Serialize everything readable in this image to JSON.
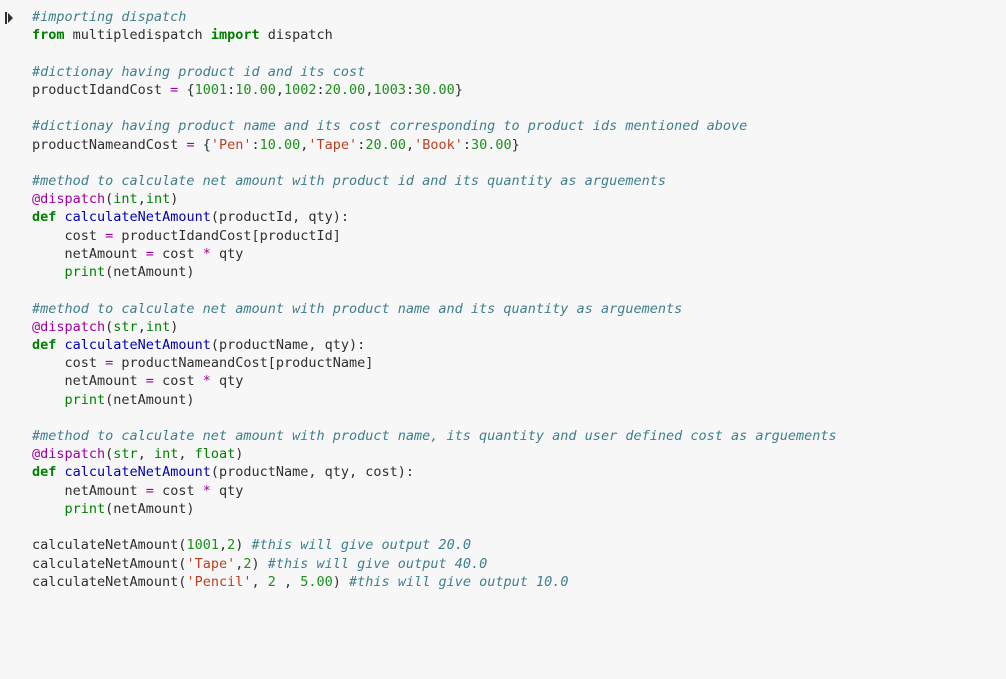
{
  "code": {
    "l1": "#importing dispatch",
    "l2a": "from",
    "l2b": " multipledispatch ",
    "l2c": "import",
    "l2d": " dispatch",
    "l4": "#dictionay having product id and its cost",
    "l5a": "productIdandCost ",
    "l5eq": "=",
    "l5b": " {",
    "l5n1": "1001",
    "l5c": ":",
    "l5n2": "10.00",
    "l5cm": ",",
    "l5n3": "1002",
    "l5c2": ":",
    "l5n4": "20.00",
    "l5cm2": ",",
    "l5n5": "1003",
    "l5c3": ":",
    "l5n6": "30.00",
    "l5e": "}",
    "l7": "#dictionay having product name and its cost corresponding to product ids mentioned above",
    "l8a": "productNameandCost ",
    "l8eq": "=",
    "l8b": " {",
    "l8s1": "'Pen'",
    "l8c": ":",
    "l8n1": "10.00",
    "l8cm": ",",
    "l8s2": "'Tape'",
    "l8c2": ":",
    "l8n2": "20.00",
    "l8cm2": ",",
    "l8s3": "'Book'",
    "l8c3": ":",
    "l8n3": "30.00",
    "l8e": "}",
    "l10": "#method to calculate net amount with product id and its quantity as arguements",
    "l11a": "@dispatch",
    "l11b": "(",
    "l11c": "int",
    "l11d": ",",
    "l11e": "int",
    "l11f": ")",
    "l12a": "def",
    "l12b": " ",
    "l12c": "calculateNetAmount",
    "l12d": "(productId, qty):",
    "l13a": "    cost ",
    "l13eq": "=",
    "l13b": " productIdandCost[productId]",
    "l14a": "    netAmount ",
    "l14eq": "=",
    "l14b": " cost ",
    "l14op": "*",
    "l14c": " qty",
    "l15a": "    ",
    "l15p": "print",
    "l15b": "(netAmount)",
    "l17": "#method to calculate net amount with product name and its quantity as arguements",
    "l18a": "@dispatch",
    "l18b": "(",
    "l18c": "str",
    "l18d": ",",
    "l18e": "int",
    "l18f": ")",
    "l19a": "def",
    "l19b": " ",
    "l19c": "calculateNetAmount",
    "l19d": "(productName, qty):",
    "l20a": "    cost ",
    "l20eq": "=",
    "l20b": " productNameandCost[productName]",
    "l21a": "    netAmount ",
    "l21eq": "=",
    "l21b": " cost ",
    "l21op": "*",
    "l21c": " qty",
    "l22a": "    ",
    "l22p": "print",
    "l22b": "(netAmount)",
    "l24": "#method to calculate net amount with product name, its quantity and user defined cost as arguements",
    "l25a": "@dispatch",
    "l25b": "(",
    "l25c": "str",
    "l25d": ", ",
    "l25e": "int",
    "l25f": ", ",
    "l25g": "float",
    "l25h": ")",
    "l26a": "def",
    "l26b": " ",
    "l26c": "calculateNetAmount",
    "l26d": "(productName, qty, cost):",
    "l27a": "    netAmount ",
    "l27eq": "=",
    "l27b": " cost ",
    "l27op": "*",
    "l27c": " qty",
    "l28a": "    ",
    "l28p": "print",
    "l28b": "(netAmount)",
    "l30a": "calculateNetAmount(",
    "l30n1": "1001",
    "l30b": ",",
    "l30n2": "2",
    "l30c": ") ",
    "l30cm": "#this will give output 20.0",
    "l31a": "calculateNetAmount(",
    "l31s": "'Tape'",
    "l31b": ",",
    "l31n": "2",
    "l31c": ") ",
    "l31cm": "#this will give output 40.0",
    "l32a": "calculateNetAmount(",
    "l32s": "'Pencil'",
    "l32b": ", ",
    "l32n1": "2",
    "l32c": " , ",
    "l32n2": "5.00",
    "l32d": ") ",
    "l32cm": "#this will give output 10.0"
  }
}
